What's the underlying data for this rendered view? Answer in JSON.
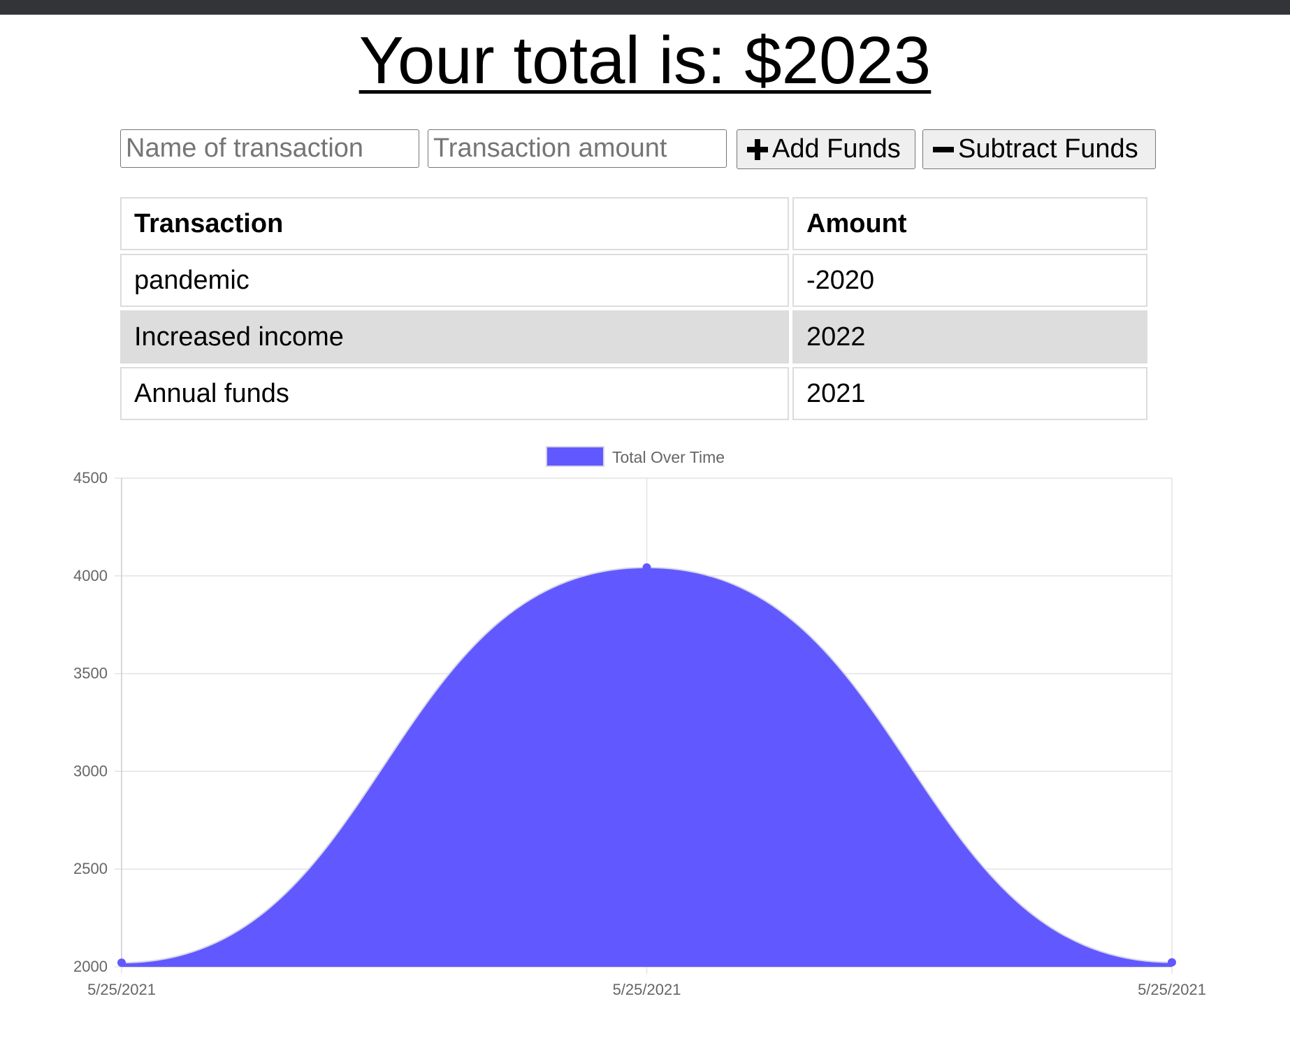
{
  "header": {
    "total_label": "Your total is: $",
    "total_value": "2023"
  },
  "form": {
    "name_placeholder": "Name of transaction",
    "amount_placeholder": "Transaction amount",
    "add_label": "Add Funds",
    "subtract_label": "Subtract Funds",
    "add_icon": "plus-icon",
    "subtract_icon": "minus-icon"
  },
  "table": {
    "headers": [
      "Transaction",
      "Amount"
    ],
    "rows": [
      {
        "name": "pandemic",
        "amount": "-2020"
      },
      {
        "name": "Increased income",
        "amount": "2022"
      },
      {
        "name": "Annual funds",
        "amount": "2021"
      }
    ]
  },
  "colors": {
    "fill": "#6159ff",
    "topbar": "#333438",
    "row_shade": "#dddddd"
  },
  "chart_data": {
    "type": "area",
    "series": [
      {
        "name": "Total Over Time",
        "values": [
          2021,
          4043,
          2023
        ]
      }
    ],
    "categories": [
      "5/25/2021",
      "5/25/2021",
      "5/25/2021"
    ],
    "ylim": [
      2000,
      4500
    ],
    "yticks": [
      "4500",
      "4000",
      "3500",
      "3000",
      "2500",
      "2000"
    ],
    "grid": true,
    "legend": "top-center",
    "smooth": true
  }
}
